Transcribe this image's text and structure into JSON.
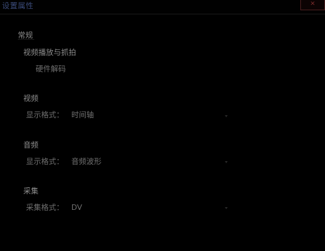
{
  "window": {
    "title": "设置属性",
    "close_label": "✕"
  },
  "tabs": [
    {
      "label": "常规"
    }
  ],
  "sections": {
    "video_snapshot": {
      "title": "视频播放与抓拍",
      "option_label": "硬件解码"
    },
    "video": {
      "title": "视频",
      "option_label": "显示格式：",
      "option_value": "时间轴"
    },
    "audio": {
      "title": "音频",
      "option_label": "显示格式：",
      "option_value": "音频波形"
    },
    "record": {
      "title": "采集",
      "option_label": "采集格式：",
      "option_value": "DV"
    }
  },
  "icons": {
    "dropdown": "chevron-down-icon",
    "close": "close-icon"
  }
}
